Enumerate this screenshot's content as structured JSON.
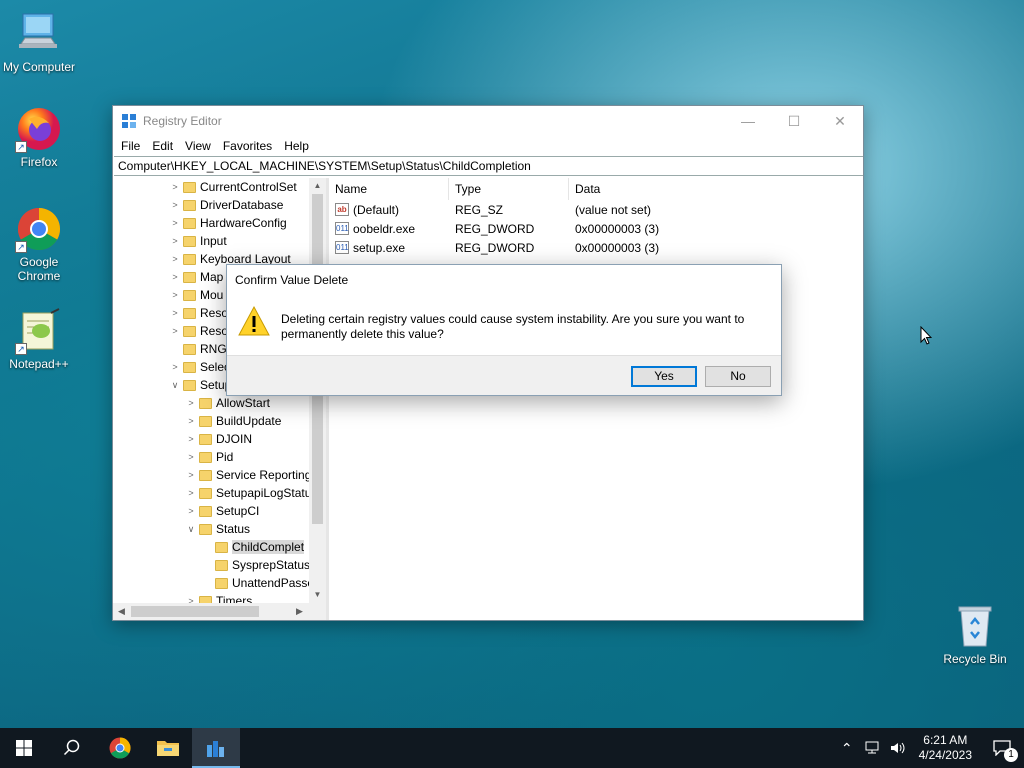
{
  "desktop": {
    "icons": [
      {
        "label": "My Computer"
      },
      {
        "label": "Firefox"
      },
      {
        "label": "Google Chrome"
      },
      {
        "label": "Notepad++"
      },
      {
        "label": "Recycle Bin"
      }
    ]
  },
  "window": {
    "title": "Registry Editor",
    "menu": [
      "File",
      "Edit",
      "View",
      "Favorites",
      "Help"
    ],
    "address": "Computer\\HKEY_LOCAL_MACHINE\\SYSTEM\\Setup\\Status\\ChildCompletion",
    "tree": [
      {
        "label": "CurrentControlSet"
      },
      {
        "label": "DriverDatabase"
      },
      {
        "label": "HardwareConfig"
      },
      {
        "label": "Input"
      },
      {
        "label": "Keyboard Layout"
      },
      {
        "label": "Map"
      },
      {
        "label": "Mou"
      },
      {
        "label": "Reso"
      },
      {
        "label": "Reso"
      },
      {
        "label": "RNG"
      },
      {
        "label": "Selec"
      },
      {
        "label": "Setup"
      },
      {
        "label": "AllowStart"
      },
      {
        "label": "BuildUpdate"
      },
      {
        "label": "DJOIN"
      },
      {
        "label": "Pid"
      },
      {
        "label": "Service Reporting"
      },
      {
        "label": "SetupapiLogStatu"
      },
      {
        "label": "SetupCI"
      },
      {
        "label": "Status"
      },
      {
        "label": "ChildComplet"
      },
      {
        "label": "SysprepStatus"
      },
      {
        "label": "UnattendPasse"
      },
      {
        "label": "Timers"
      }
    ],
    "columns": {
      "name": "Name",
      "type": "Type",
      "data": "Data"
    },
    "values": [
      {
        "name": "(Default)",
        "type": "REG_SZ",
        "data": "(value not set)",
        "icon": "ab"
      },
      {
        "name": "oobeldr.exe",
        "type": "REG_DWORD",
        "data": "0x00000003 (3)",
        "icon": "011"
      },
      {
        "name": "setup.exe",
        "type": "REG_DWORD",
        "data": "0x00000003 (3)",
        "icon": "011"
      }
    ]
  },
  "dialog": {
    "title": "Confirm Value Delete",
    "message": "Deleting certain registry values could cause system instability. Are you sure you want to permanently delete this value?",
    "yes": "Yes",
    "no": "No"
  },
  "taskbar": {
    "time": "6:21 AM",
    "date": "4/24/2023",
    "notification_count": "1"
  }
}
